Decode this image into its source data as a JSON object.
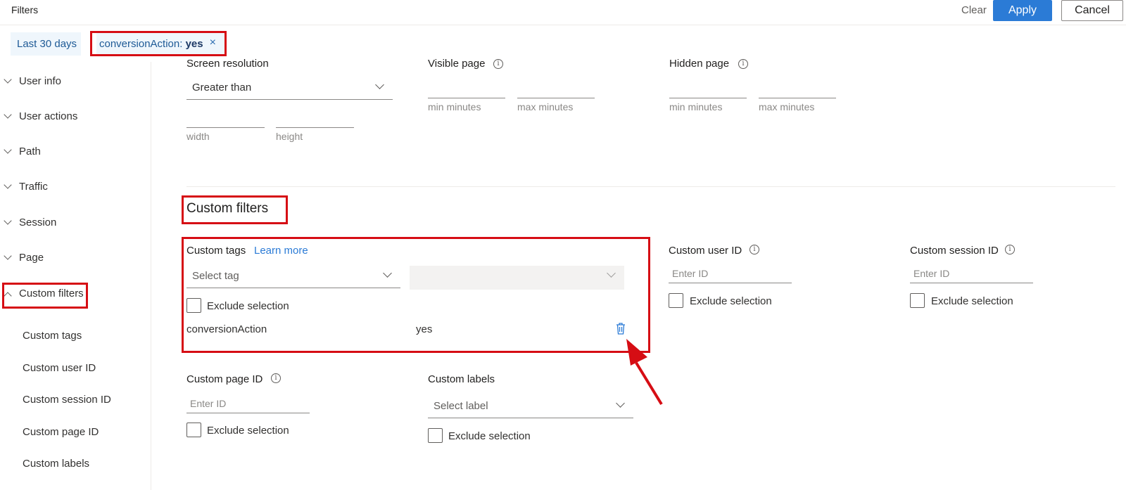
{
  "header": {
    "title": "Filters",
    "clear_label": "Clear",
    "apply_label": "Apply",
    "cancel_label": "Cancel"
  },
  "pills": {
    "date": "Last 30 days",
    "tag_key": "conversionAction:",
    "tag_value": "yes",
    "remove_icon": "×"
  },
  "sidebar": {
    "items": [
      {
        "label": "User info"
      },
      {
        "label": "User actions"
      },
      {
        "label": "Path"
      },
      {
        "label": "Traffic"
      },
      {
        "label": "Session"
      },
      {
        "label": "Page"
      },
      {
        "label": "Custom filters"
      }
    ],
    "subitems": [
      {
        "label": "Custom tags"
      },
      {
        "label": "Custom user ID"
      },
      {
        "label": "Custom session ID"
      },
      {
        "label": "Custom page ID"
      },
      {
        "label": "Custom labels"
      }
    ]
  },
  "screen": {
    "label": "Screen resolution",
    "operator": "Greater than",
    "width_label": "width",
    "height_label": "height"
  },
  "visible_page": {
    "label": "Visible page",
    "min_label": "min minutes",
    "max_label": "max minutes"
  },
  "hidden_page": {
    "label": "Hidden page",
    "min_label": "min minutes",
    "max_label": "max minutes"
  },
  "custom": {
    "section_title": "Custom filters",
    "tags": {
      "label": "Custom tags",
      "learn_more": "Learn more",
      "select_placeholder": "Select tag",
      "exclude_label": "Exclude selection",
      "row_key": "conversionAction",
      "row_value": "yes"
    },
    "user_id": {
      "label": "Custom user ID",
      "placeholder": "Enter ID",
      "exclude_label": "Exclude selection"
    },
    "session_id": {
      "label": "Custom session ID",
      "placeholder": "Enter ID",
      "exclude_label": "Exclude selection"
    },
    "page_id": {
      "label": "Custom page ID",
      "placeholder": "Enter ID",
      "exclude_label": "Exclude selection"
    },
    "labels": {
      "label": "Custom labels",
      "select_placeholder": "Select label",
      "exclude_label": "Exclude selection"
    }
  },
  "colors": {
    "accent": "#2b7bd6",
    "highlight": "#d60d14",
    "pill_bg": "#eff6fc"
  },
  "icons": {
    "info": "i",
    "trash": "trash-icon",
    "chevron": "chevron-down-icon"
  }
}
